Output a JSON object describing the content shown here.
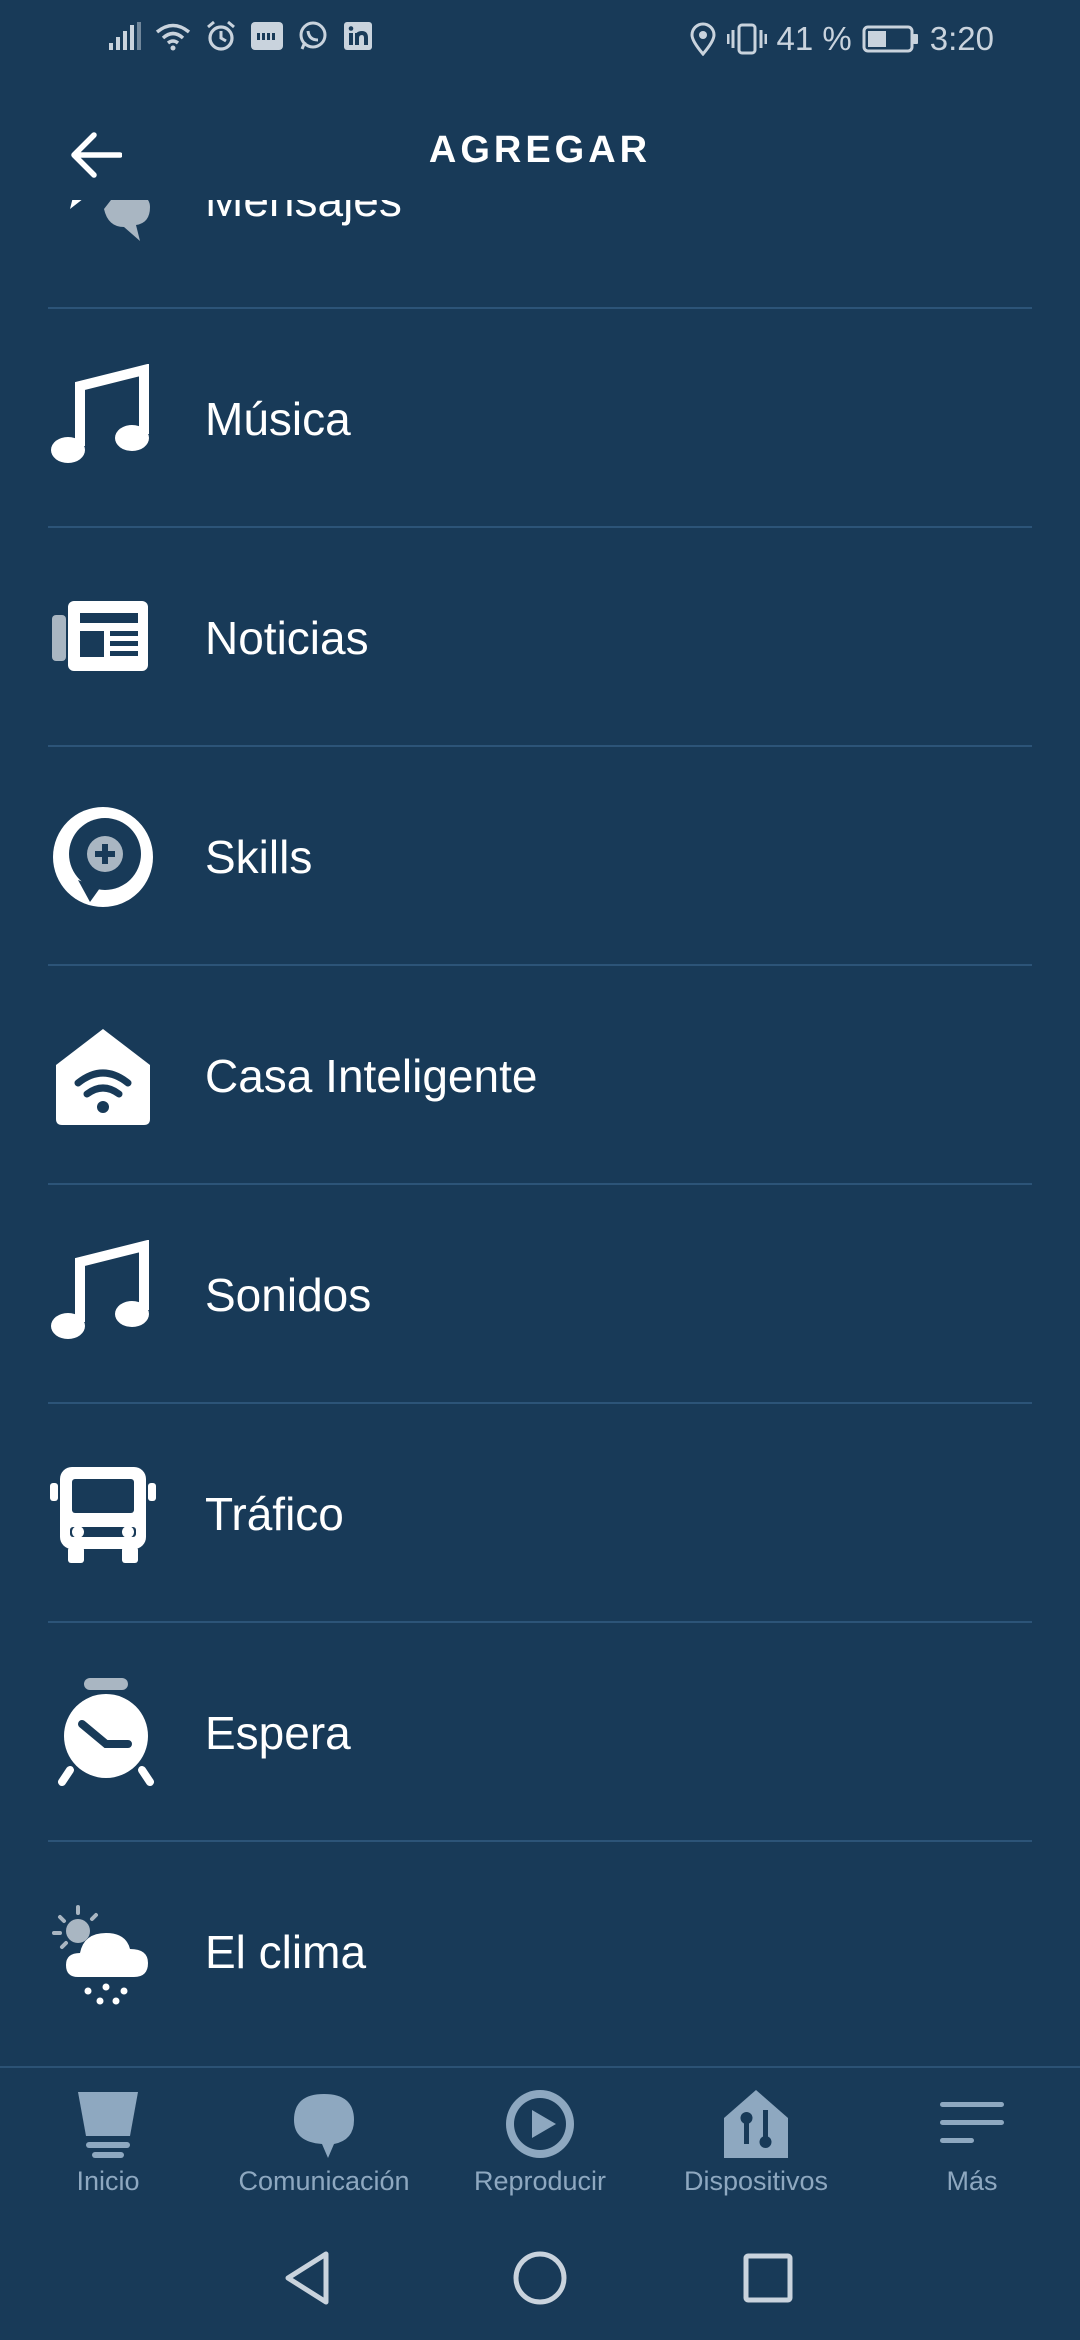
{
  "status_bar": {
    "battery_percent": "41 %",
    "time": "3:20",
    "left_icons": [
      "signal-icon",
      "wifi-icon",
      "alarm-icon",
      "ifttt-icon",
      "whatsapp-icon",
      "linkedin-icon"
    ],
    "right_icons": [
      "location-icon",
      "vibrate-icon",
      "battery-icon"
    ]
  },
  "header": {
    "title": "AGREGAR",
    "back_icon": "arrow-left-icon"
  },
  "list": {
    "items": [
      {
        "label": "Mensajes",
        "icon": "messages-icon"
      },
      {
        "label": "Música",
        "icon": "music-note-icon"
      },
      {
        "label": "Noticias",
        "icon": "newspaper-icon"
      },
      {
        "label": "Skills",
        "icon": "skills-plus-icon"
      },
      {
        "label": "Casa Inteligente",
        "icon": "smart-home-icon"
      },
      {
        "label": "Sonidos",
        "icon": "music-note-icon"
      },
      {
        "label": "Tráfico",
        "icon": "bus-icon"
      },
      {
        "label": "Espera",
        "icon": "alarm-clock-icon"
      },
      {
        "label": "El clima",
        "icon": "weather-icon"
      }
    ]
  },
  "bottom_nav": {
    "tabs": [
      {
        "label": "Inicio",
        "icon": "home-icon"
      },
      {
        "label": "Comunicación",
        "icon": "chat-bubble-icon"
      },
      {
        "label": "Reproducir",
        "icon": "play-icon"
      },
      {
        "label": "Dispositivos",
        "icon": "devices-icon"
      },
      {
        "label": "Más",
        "icon": "menu-icon"
      }
    ]
  },
  "system_nav": {
    "buttons": [
      "back-triangle-icon",
      "home-circle-icon",
      "recents-square-icon"
    ]
  },
  "colors": {
    "background": "#183a58",
    "divider": "#2c5478",
    "nav_inactive": "#8ea8c0",
    "text": "#ffffff"
  }
}
